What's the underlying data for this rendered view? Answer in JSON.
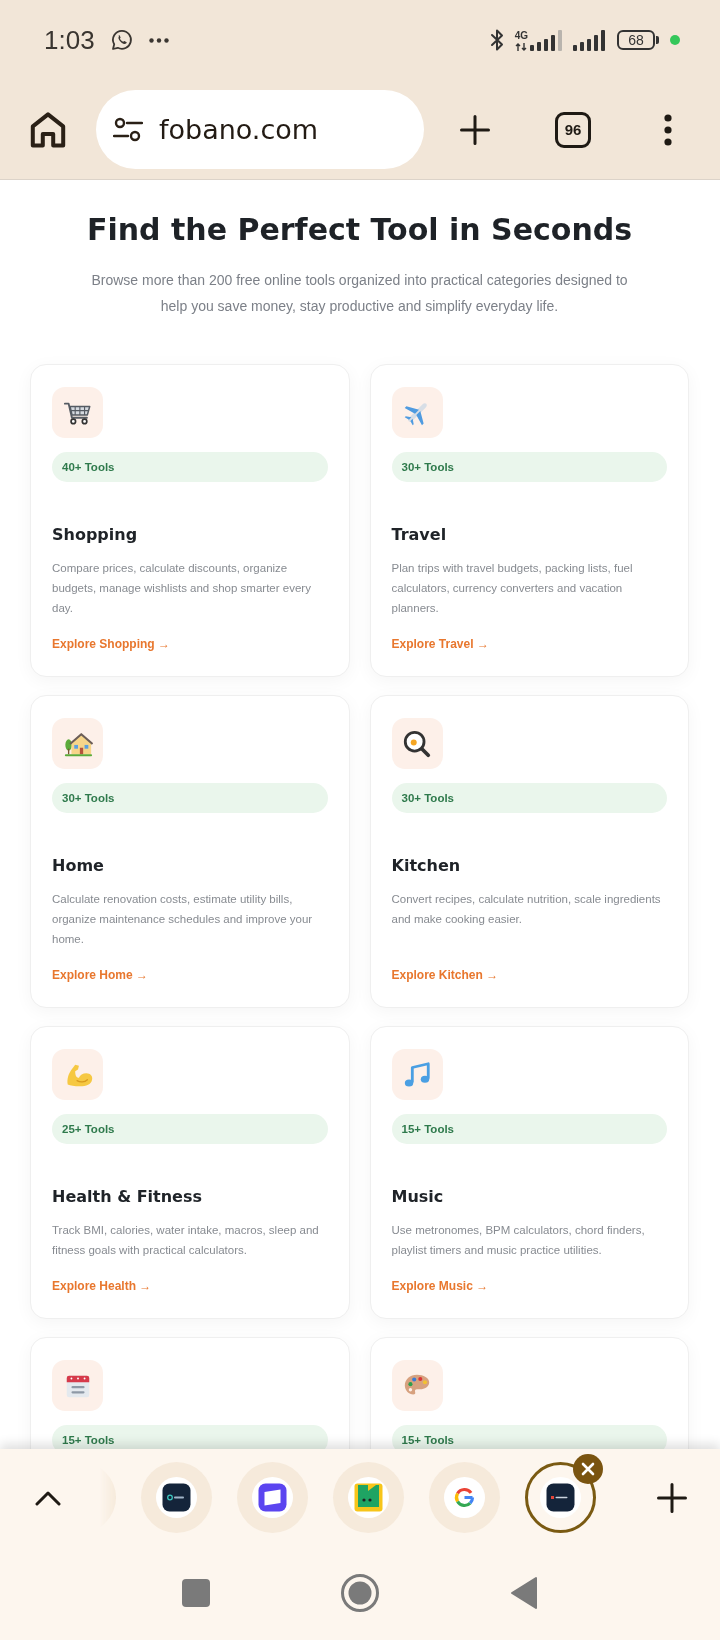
{
  "status_bar": {
    "time": "1:03",
    "network": "4G",
    "battery": "68"
  },
  "toolbar": {
    "url": "fobano.com",
    "tab_count": "96"
  },
  "page": {
    "heading": "Find the Perfect Tool in Seconds",
    "subtitle": "Browse more than 200 free online tools organized into practical categories designed to help you save money, stay productive and simplify everyday life.",
    "categories": [
      {
        "kind": "cart",
        "count": "40+ Tools",
        "title": "Shopping",
        "description": "Compare prices, calculate discounts, organize budgets, manage wishlists and shop smarter every day.",
        "link": "Explore Shopping →"
      },
      {
        "kind": "plane",
        "count": "30+ Tools",
        "title": "Travel",
        "description": "Plan trips with travel budgets, packing lists, fuel calculators, currency converters and vacation planners.",
        "link": "Explore Travel →"
      },
      {
        "kind": "house",
        "count": "30+ Tools",
        "title": "Home",
        "description": "Calculate renovation costs, estimate utility bills, organize maintenance schedules and improve your home.",
        "link": "Explore Home →"
      },
      {
        "kind": "pan",
        "count": "30+ Tools",
        "title": "Kitchen",
        "description": "Convert recipes, calculate nutrition, scale ingredients and make cooking easier.",
        "link": "Explore Kitchen →"
      },
      {
        "kind": "muscle",
        "count": "25+ Tools",
        "title": "Health & Fitness",
        "description": "Track BMI, calories, water intake, macros, sleep and fitness goals with practical calculators.",
        "link": "Explore Health →"
      },
      {
        "kind": "music",
        "count": "15+ Tools",
        "title": "Music",
        "description": "Use metronomes, BPM calculators, chord finders, playlist timers and music practice utilities.",
        "link": "Explore Music →"
      },
      {
        "kind": "calendar",
        "count": "15+ Tools"
      },
      {
        "kind": "palette",
        "count": "15+ Tools"
      }
    ]
  },
  "tab_strip": {
    "tabs": [
      {
        "kind": "offscreen",
        "selected": false
      },
      {
        "kind": "logo",
        "selected": false
      },
      {
        "kind": "panel",
        "selected": false
      },
      {
        "kind": "mascot",
        "selected": false
      },
      {
        "kind": "google",
        "selected": false
      },
      {
        "kind": "wordmark",
        "selected": true
      }
    ]
  }
}
